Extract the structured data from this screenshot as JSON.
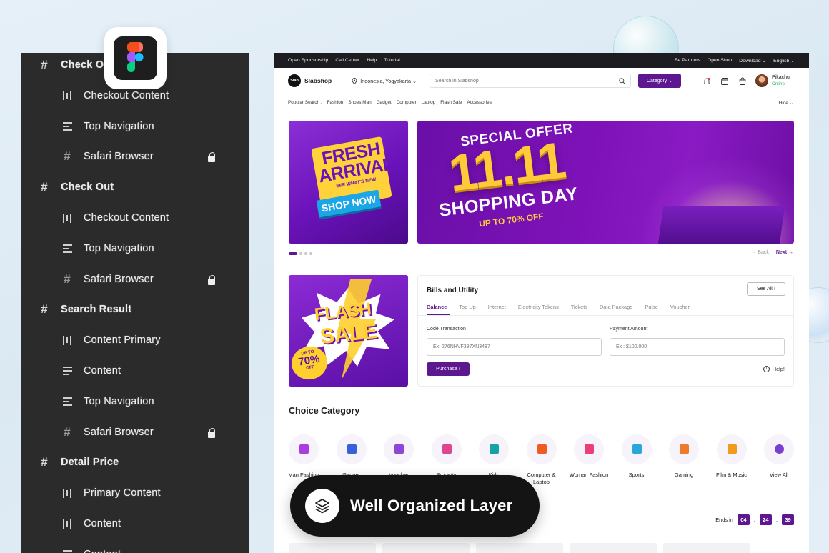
{
  "layers": [
    {
      "label": "Check Out",
      "level": 0,
      "icon": "hash-icon",
      "locked": false
    },
    {
      "label": "Checkout Content",
      "level": 1,
      "icon": "columns-icon",
      "locked": false
    },
    {
      "label": "Top Navigation",
      "level": 1,
      "icon": "rows-icon",
      "locked": false
    },
    {
      "label": "Safari Browser",
      "level": 1,
      "icon": "hash-icon",
      "locked": true
    },
    {
      "label": "Check Out",
      "level": 0,
      "icon": "hash-icon",
      "locked": false
    },
    {
      "label": "Checkout Content",
      "level": 1,
      "icon": "columns-icon",
      "locked": false
    },
    {
      "label": "Top Navigation",
      "level": 1,
      "icon": "rows-icon",
      "locked": false
    },
    {
      "label": "Safari Browser",
      "level": 1,
      "icon": "hash-icon",
      "locked": true
    },
    {
      "label": "Search Result",
      "level": 0,
      "icon": "hash-icon",
      "locked": false
    },
    {
      "label": "Content Primary",
      "level": 1,
      "icon": "columns-icon",
      "locked": false
    },
    {
      "label": "Content",
      "level": 1,
      "icon": "rows-left-icon",
      "locked": false
    },
    {
      "label": "Top Navigation",
      "level": 1,
      "icon": "rows-icon",
      "locked": false
    },
    {
      "label": "Safari Browser",
      "level": 1,
      "icon": "hash-icon",
      "locked": true
    },
    {
      "label": "Detail Price",
      "level": 0,
      "icon": "hash-icon",
      "locked": false
    },
    {
      "label": "Primary Content",
      "level": 1,
      "icon": "columns-icon",
      "locked": false
    },
    {
      "label": "Content",
      "level": 1,
      "icon": "columns-icon",
      "locked": false
    },
    {
      "label": "Content",
      "level": 1,
      "icon": "rows-icon",
      "locked": false
    }
  ],
  "utilbar": {
    "left": [
      "Open Sponsorship",
      "Call Center",
      "Help",
      "Tutorial"
    ],
    "right": [
      "Be Partners",
      "Open Shop",
      "Download ⌄",
      "English ⌄"
    ]
  },
  "nav": {
    "logo": "Slab",
    "brand": "Slabshop",
    "location": "Indonesia, Yogyakarta ⌄",
    "search_placeholder": "Search in Slabshop",
    "category": "Category ⌄",
    "user": "Pikachu",
    "status": "Online"
  },
  "popular": {
    "label": "Popular Search :",
    "items": [
      "Fashion",
      "Shoes Man",
      "Gadget",
      "Computer",
      "Laptop",
      "Flash Sale",
      "Accessories"
    ],
    "hide": "Hide ⌄"
  },
  "banner_fresh": {
    "line1": "FRESH",
    "line2": "ARRIVAL",
    "line3": "SEE WHAT'S NEW",
    "cta": "SHOP NOW"
  },
  "banner_offer": {
    "title": "SPECIAL OFFER",
    "number": "11.11",
    "sub": "SHOPPING DAY",
    "off": "UP TO 70% OFF"
  },
  "pager": {
    "back": "← Back",
    "next": "Next →"
  },
  "flash": {
    "line1": "FLASH",
    "line2": "SALE",
    "upto": "UP TO",
    "pct": "70%",
    "off": "OFF"
  },
  "bills": {
    "title": "Bills and Utility",
    "see_all": "See All ›",
    "tabs": [
      "Balance",
      "Top Up",
      "Internet",
      "Electricity Tokens",
      "Tickets",
      "Data Package",
      "Pulse",
      "Voucher"
    ],
    "code_label": "Code Transaction",
    "code_placeholder": "Ex: 276NHVF387XN3487",
    "amount_label": "Payment Amount",
    "amount_placeholder": "Ex : $100.000",
    "purchase": "Purchase ›",
    "help": "Help!"
  },
  "choice": {
    "title": "Choice Category",
    "items": [
      {
        "label": "Man Fashion",
        "color": "#a93ee0"
      },
      {
        "label": "Gadget",
        "color": "#3b5fd8"
      },
      {
        "label": "Voucher",
        "color": "#8d46d6"
      },
      {
        "label": "Property",
        "color": "#e0468f"
      },
      {
        "label": "Kids",
        "color": "#17a2a8"
      },
      {
        "label": "Computer & Laptop",
        "color": "#f05a23"
      },
      {
        "label": "Woman Fashion",
        "color": "#ec3f7a"
      },
      {
        "label": "Sports",
        "color": "#2aa7d9"
      },
      {
        "label": "Gaming",
        "color": "#f07a2b"
      },
      {
        "label": "Film & Music",
        "color": "#f29a1c"
      },
      {
        "label": "View All",
        "color": "#7a3fd0"
      }
    ]
  },
  "countdown": {
    "label": "Ends in",
    "h": "04",
    "m": "24",
    "s": "39",
    "sep": ":"
  },
  "pill": {
    "text": "Well Organized Layer"
  },
  "colors": {
    "primary": "#5d1890",
    "panel": "#2b2b2b",
    "accent_gold": "#ffc93a"
  }
}
